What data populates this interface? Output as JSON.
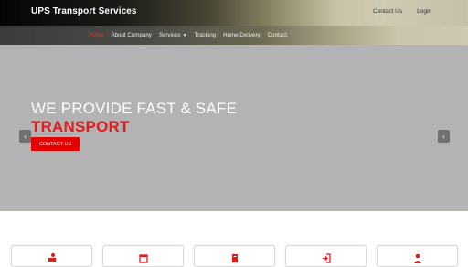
{
  "header": {
    "brand": "UPS Transport Services",
    "links": [
      {
        "label": "Contact Us"
      },
      {
        "label": "Login"
      }
    ]
  },
  "nav": {
    "items": [
      {
        "label": "Home",
        "active": true
      },
      {
        "label": "About Company"
      },
      {
        "label": "Services",
        "has_dropdown": true
      },
      {
        "label": "Tracking"
      },
      {
        "label": "Home Delivery"
      },
      {
        "label": "Contact"
      }
    ]
  },
  "hero": {
    "line1": "WE PROVIDE FAST & SAFE",
    "line2": "TRANSPORT",
    "button": "CONTACT US",
    "prev_arrow": "‹",
    "next_arrow": "›"
  },
  "cards": [
    {
      "icon": "location-truck-icon"
    },
    {
      "icon": "calendar-icon"
    },
    {
      "icon": "checklist-icon"
    },
    {
      "icon": "sign-in-icon"
    },
    {
      "icon": "user-icon"
    }
  ],
  "colors": {
    "accent": "#e31b1b",
    "button": "#e50000",
    "hero_bg": "#b3b2b4"
  }
}
